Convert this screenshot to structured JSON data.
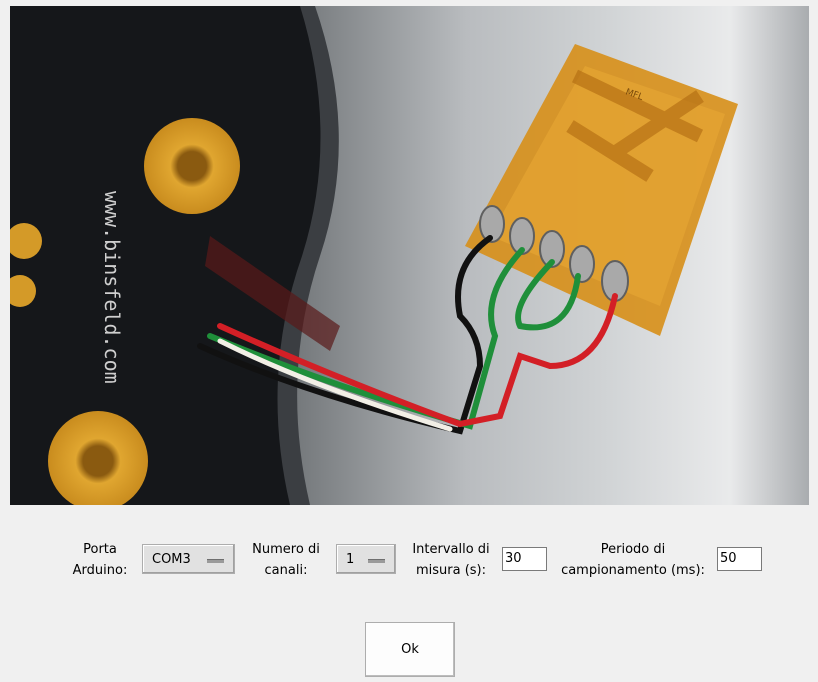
{
  "form": {
    "porta_label_line1": "Porta",
    "porta_label_line2": "Arduino:",
    "porta_value": "COM3",
    "canali_label_line1": "Numero di",
    "canali_label_line2": "canali:",
    "canali_value": "1",
    "intervallo_label_line1": "Intervallo di",
    "intervallo_label_line2": "misura (s):",
    "intervallo_value": "30",
    "periodo_label_line1": "Periodo di",
    "periodo_label_line2": "campionamento (ms):",
    "periodo_value": "50",
    "ok_label": "Ok"
  },
  "photo": {
    "board_print": "www.binsfeld.com",
    "gauge_mark": "MFL"
  }
}
